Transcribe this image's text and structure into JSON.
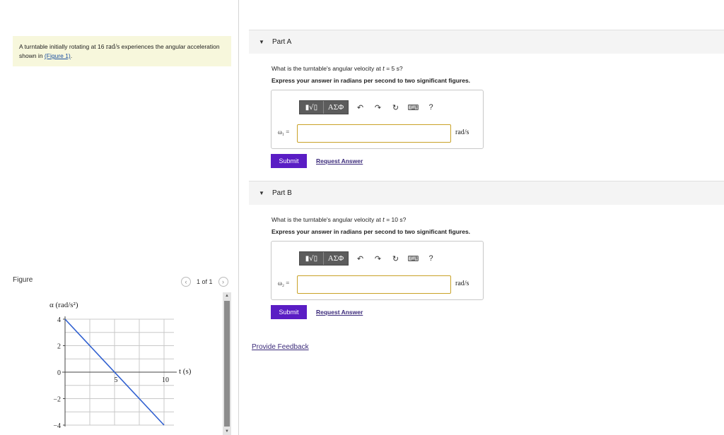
{
  "problem": {
    "text_before": "A turntable initially rotating at 16 ",
    "rate_unit": "rad/s",
    "text_after": " experiences the angular acceleration shown in ",
    "figure_link": "(Figure 1)",
    "end_punct": "."
  },
  "figure": {
    "label": "Figure",
    "prev_icon": "chevron-left-icon",
    "next_icon": "chevron-right-icon",
    "count": "1 of 1"
  },
  "chart_data": {
    "type": "line",
    "ylabel": "α (rad/s²)",
    "xlabel": "t (s)",
    "x_ticks": [
      "5",
      "10"
    ],
    "y_ticks": [
      "4",
      "2",
      "0",
      "−2",
      "−4"
    ],
    "xlim": [
      0,
      11
    ],
    "ylim": [
      -4,
      4
    ],
    "grid": true,
    "series": [
      {
        "x": [
          0,
          10
        ],
        "y": [
          4,
          -4
        ],
        "color": "#2f5fd0"
      }
    ]
  },
  "parts": [
    {
      "title": "Part A",
      "question_prefix": "What is the turntable's angular velocity at ",
      "question_var": "t",
      "question_suffix": " = 5 s?",
      "instruction": "Express your answer in radians per second to two significant figures.",
      "toolbar": {
        "template": "▮√▯",
        "symbols": "ΑΣΦ",
        "undo": "↶",
        "redo": "↷",
        "reset": "↻",
        "keyboard": "⌨",
        "help": "?"
      },
      "answer_label": "ω₁ =",
      "answer_value": "",
      "unit": "rad/s",
      "submit": "Submit",
      "request": "Request Answer"
    },
    {
      "title": "Part B",
      "question_prefix": "What is the turntable's angular velocity at ",
      "question_var": "t",
      "question_suffix": " = 10 s?",
      "instruction": "Express your answer in radians per second to two significant figures.",
      "toolbar": {
        "template": "▮√▯",
        "symbols": "ΑΣΦ",
        "undo": "↶",
        "redo": "↷",
        "reset": "↻",
        "keyboard": "⌨",
        "help": "?"
      },
      "answer_label": "ω₂ =",
      "answer_value": "",
      "unit": "rad/s",
      "submit": "Submit",
      "request": "Request Answer"
    }
  ],
  "feedback": "Provide Feedback",
  "part_toggle_icon": "▼",
  "scroll_up": "▲",
  "scroll_down": "▼"
}
